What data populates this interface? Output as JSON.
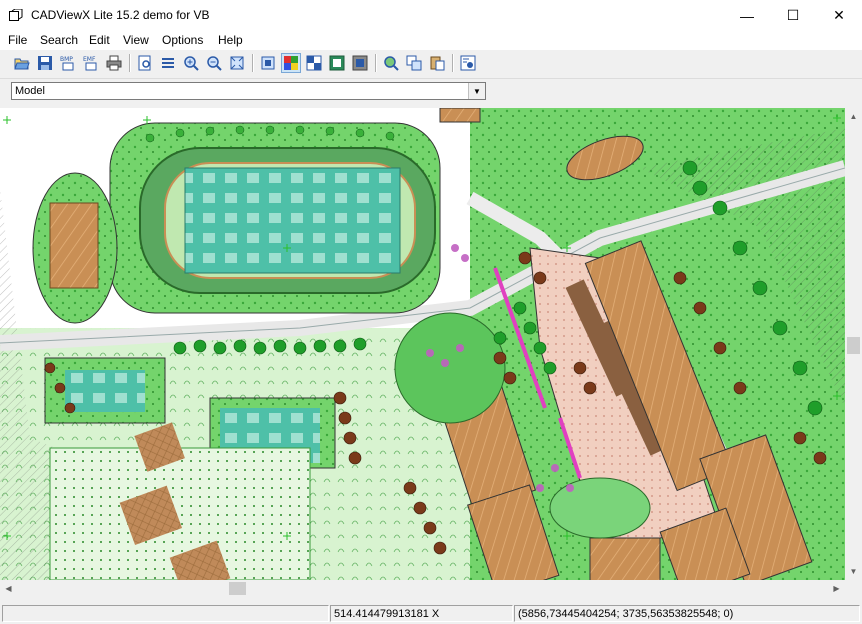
{
  "window": {
    "title": "CADViewX Lite 15.2 demo for VB",
    "minimize": "—",
    "maximize": "☐",
    "close": "✕"
  },
  "menu": [
    "File",
    "Search",
    "Edit",
    "View",
    "Options",
    "Help"
  ],
  "toolbar": {
    "buttons": [
      "open-icon",
      "save-icon",
      "export-bmp-icon",
      "export-emf-icon",
      "print-icon",
      "zoom-page-icon",
      "layers-icon",
      "zoom-in-icon",
      "zoom-out-icon",
      "fit-icon",
      "view-3d-icon",
      "color-mode-icon",
      "black-white-icon",
      "display-mode-icon",
      "hide-icon",
      "find-icon",
      "copy-icon",
      "paste-icon",
      "settings-icon"
    ],
    "bmp_label": "BMP",
    "emf_label": "EMF"
  },
  "layout": {
    "selected": "Model"
  },
  "status": {
    "scale": "514.414479913181 X",
    "coords": "(5856,73445404254; 3735,56353825548; 0)"
  },
  "colors": {
    "building": "#c98f55",
    "grass": "#6fd26a",
    "pitch": "#4ec0a8",
    "tree": "#1f9e2a"
  }
}
